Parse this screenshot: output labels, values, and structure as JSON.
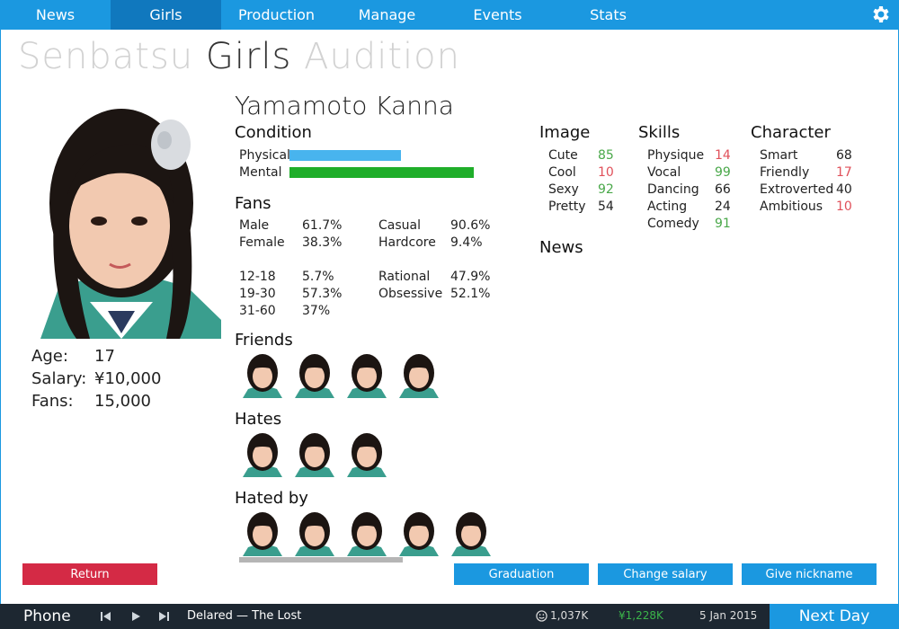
{
  "nav": {
    "tabs": [
      {
        "label": "News"
      },
      {
        "label": "Girls"
      },
      {
        "label": "Production"
      },
      {
        "label": "Manage"
      },
      {
        "label": "Events"
      },
      {
        "label": "Stats"
      }
    ],
    "active_tab": "Girls"
  },
  "title": {
    "part1": "Senbatsu",
    "part2": "Girls",
    "part3": "Audition"
  },
  "profile": {
    "name": "Yamamoto Kanna",
    "age_label": "Age:",
    "age": "17",
    "salary_label": "Salary:",
    "salary": "¥10,000",
    "fans_label": "Fans:",
    "fans": "15,000"
  },
  "condition": {
    "heading": "Condition",
    "physical_label": "Physical",
    "physical_level": 0.6,
    "mental_label": "Mental",
    "mental_level": 0.99,
    "physical_color": "#48b4ee",
    "mental_color": "#1fae2a"
  },
  "fans_section": {
    "heading": "Fans",
    "rows": [
      {
        "label": "Male",
        "value": "61.7%",
        "label2": "Casual",
        "value2": "90.6%"
      },
      {
        "label": "Female",
        "value": "38.3%",
        "label2": "Hardcore",
        "value2": "9.4%"
      },
      {
        "label": "12-18",
        "value": "5.7%",
        "label2": "Rational",
        "value2": "47.9%"
      },
      {
        "label": "19-30",
        "value": "57.3%",
        "label2": "Obsessive",
        "value2": "52.1%"
      },
      {
        "label": "31-60",
        "value": "37%",
        "label2": "",
        "value2": ""
      }
    ]
  },
  "relations": {
    "friends": "Friends",
    "hates": "Hates",
    "hated_by": "Hated by"
  },
  "image": {
    "heading": "Image",
    "stats": [
      {
        "label": "Cute",
        "value": "85",
        "tone": "green"
      },
      {
        "label": "Cool",
        "value": "10",
        "tone": "red"
      },
      {
        "label": "Sexy",
        "value": "92",
        "tone": "green"
      },
      {
        "label": "Pretty",
        "value": "54",
        "tone": "plain"
      }
    ]
  },
  "skills": {
    "heading": "Skills",
    "stats": [
      {
        "label": "Physique",
        "value": "14",
        "tone": "red"
      },
      {
        "label": "Vocal",
        "value": "99",
        "tone": "green"
      },
      {
        "label": "Dancing",
        "value": "66",
        "tone": "plain"
      },
      {
        "label": "Acting",
        "value": "24",
        "tone": "plain"
      },
      {
        "label": "Comedy",
        "value": "91",
        "tone": "green"
      }
    ]
  },
  "character": {
    "heading": "Character",
    "stats": [
      {
        "label": "Smart",
        "value": "68",
        "tone": "plain"
      },
      {
        "label": "Friendly",
        "value": "17",
        "tone": "red"
      },
      {
        "label": "Extroverted",
        "value": "40",
        "tone": "plain"
      },
      {
        "label": "Ambitious",
        "value": "10",
        "tone": "red"
      }
    ]
  },
  "news": {
    "heading": "News"
  },
  "buttons": {
    "return": "Return",
    "graduation": "Graduation",
    "change_salary": "Change salary",
    "give_nickname": "Give nickname"
  },
  "bottom": {
    "phone": "Phone",
    "track": "Delared — The Lost",
    "fans": "1,037K",
    "money": "¥1,228K",
    "date": "5 Jan 2015",
    "next_day": "Next Day"
  },
  "colors": {
    "nav_blue": "#1b98e0",
    "nav_active": "#1078be",
    "return_red": "#d42a45",
    "bottom_dark": "#1d2731",
    "stat_green": "#4aa84a",
    "stat_red": "#e0505a"
  }
}
